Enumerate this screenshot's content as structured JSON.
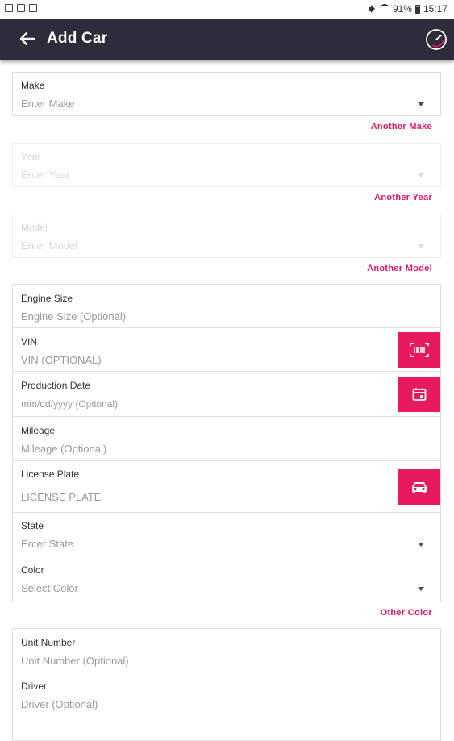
{
  "status_bar": {
    "battery": "91%",
    "time": "15:17"
  },
  "app_bar": {
    "title": "Add Car"
  },
  "make": {
    "label": "Make",
    "placeholder": "Enter Make",
    "link": "Another Make"
  },
  "year": {
    "label": "Year",
    "placeholder": "Enter Year",
    "link": "Another Year"
  },
  "model": {
    "label": "Model",
    "placeholder": "Enter Model",
    "link": "Another Model"
  },
  "engine_size": {
    "label": "Engine Size",
    "placeholder": "Engine Size (Optional)"
  },
  "vin": {
    "label": "VIN",
    "placeholder": "VIN (OPTIONAL)"
  },
  "production_date": {
    "label": "Production Date",
    "placeholder": "mm/dd/yyyy (Optional)"
  },
  "mileage": {
    "label": "Mileage",
    "placeholder": "Mileage (Optional)"
  },
  "license_plate": {
    "label": "License Plate",
    "placeholder": "LICENSE PLATE"
  },
  "state": {
    "label": "State",
    "placeholder": "Enter State"
  },
  "color": {
    "label": "Color",
    "placeholder": "Select Color",
    "link": "Other Color"
  },
  "unit_number": {
    "label": "Unit Number",
    "placeholder": "Unit Number (Optional)"
  },
  "driver": {
    "label": "Driver",
    "placeholder": "Driver (Optional)"
  },
  "colors": {
    "app_bar": "#2e2b3b",
    "accent": "#e8195f",
    "link": "#d81b60"
  },
  "icons": {
    "back": "arrow-left-icon",
    "gauge": "speedometer-icon",
    "vin": "barcode-icon",
    "date": "calendar-icon",
    "plate": "car-icon"
  }
}
